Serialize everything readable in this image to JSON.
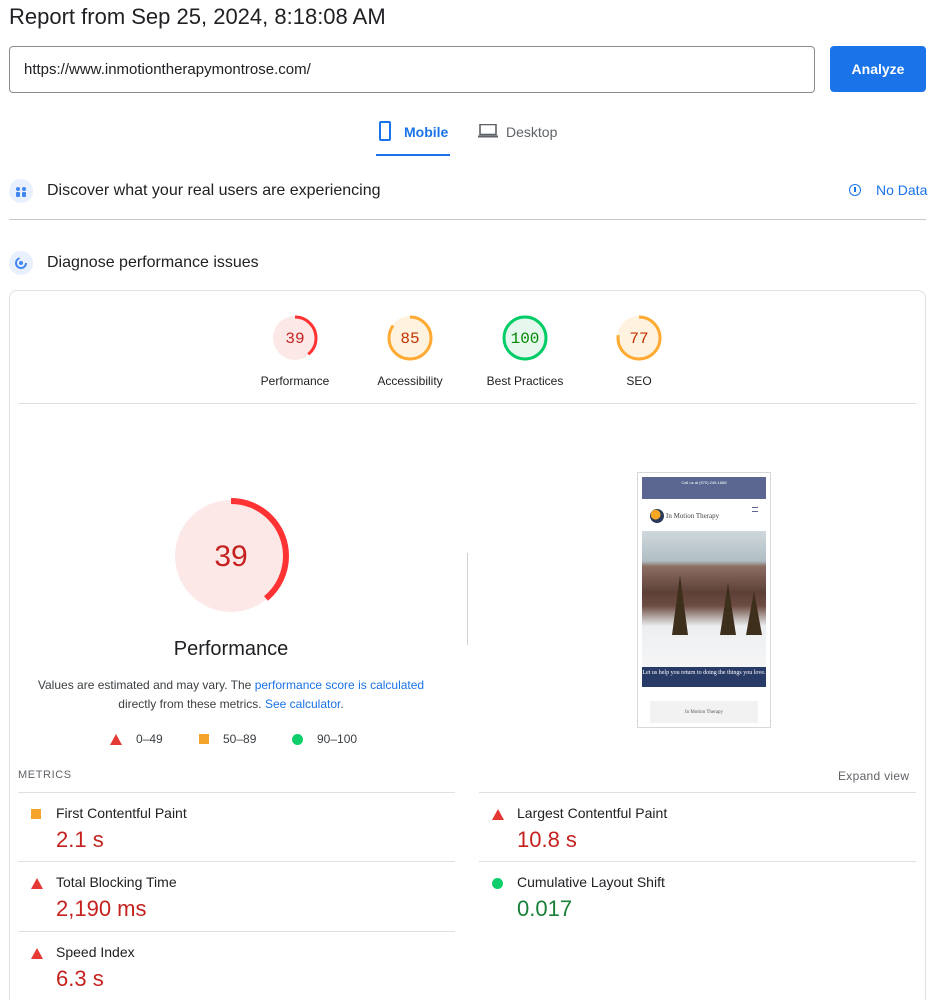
{
  "header": {
    "title": "Report from Sep 25, 2024, 8:18:08 AM"
  },
  "search": {
    "url_value": "https://www.inmotiontherapymontrose.com/",
    "analyze_label": "Analyze"
  },
  "tabs": [
    {
      "label": "Mobile",
      "active": true,
      "icon": "phone-icon"
    },
    {
      "label": "Desktop",
      "active": false,
      "icon": "laptop-icon"
    }
  ],
  "discover": {
    "title": "Discover what your real users are experiencing",
    "status": "No Data",
    "icon": "users-icon"
  },
  "diagnose": {
    "title": "Diagnose performance issues",
    "icon": "gauge-icon"
  },
  "categories": [
    {
      "label": "Performance",
      "score": 39,
      "rating": "fail",
      "color": "#ff3333"
    },
    {
      "label": "Accessibility",
      "score": 85,
      "rating": "average",
      "color": "#ffaa33"
    },
    {
      "label": "Best Practices",
      "score": 100,
      "rating": "pass",
      "color": "#00cc66"
    },
    {
      "label": "SEO",
      "score": 77,
      "rating": "average",
      "color": "#ffaa33"
    }
  ],
  "performance": {
    "score": 39,
    "title": "Performance",
    "note_prefix": "Values are estimated and may vary. The",
    "note_link": "performance score is calculated",
    "note_middle": "directly from these metrics.",
    "note_calc": "See calculator",
    "note_end": "."
  },
  "legend": [
    {
      "range": "0–49",
      "shape": "triangle",
      "color": "#e53935"
    },
    {
      "range": "50–89",
      "shape": "square",
      "color": "#f4a42b"
    },
    {
      "range": "90–100",
      "shape": "circle",
      "color": "#0cce6b"
    }
  ],
  "screenshot": {
    "top_bar": "Call us at (970) 249-1688",
    "logo_text": "In Motion Therapy",
    "banner": "Let us help you return to doing the things you love.",
    "footer_logo": "In Motion Therapy"
  },
  "metrics": {
    "section_label": "METRICS",
    "expand_label": "Expand view",
    "items": [
      {
        "name": "First Contentful Paint",
        "value": "2.1 s",
        "rating": "average"
      },
      {
        "name": "Largest Contentful Paint",
        "value": "10.8 s",
        "rating": "fail"
      },
      {
        "name": "Total Blocking Time",
        "value": "2,190 ms",
        "rating": "fail"
      },
      {
        "name": "Cumulative Layout Shift",
        "value": "0.017",
        "rating": "pass"
      },
      {
        "name": "Speed Index",
        "value": "6.3 s",
        "rating": "fail"
      }
    ]
  },
  "colors": {
    "accent": "#1a73e8",
    "fail": "#c5221f",
    "pass": "#188038"
  }
}
